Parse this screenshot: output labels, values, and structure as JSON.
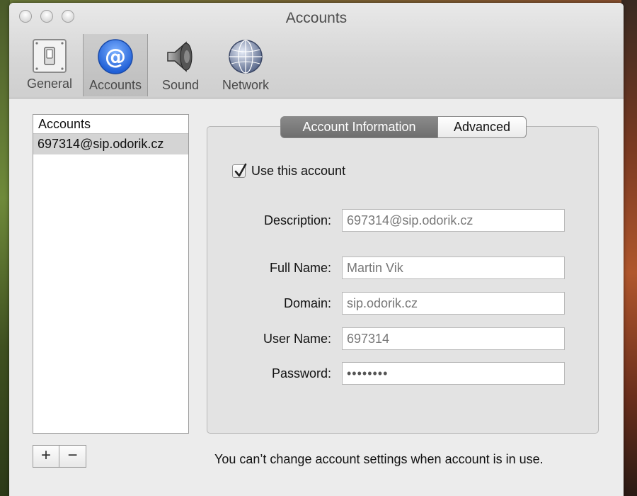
{
  "window": {
    "title": "Accounts"
  },
  "toolbar": {
    "items": [
      {
        "label": "General",
        "icon": "general-switch-icon"
      },
      {
        "label": "Accounts",
        "icon": "at-sign-icon"
      },
      {
        "label": "Sound",
        "icon": "speaker-icon"
      },
      {
        "label": "Network",
        "icon": "globe-icon"
      }
    ],
    "selected": "Accounts"
  },
  "sidebar": {
    "header": "Accounts",
    "items": [
      {
        "label": "697314@sip.odorik.cz",
        "selected": true
      }
    ],
    "add_label": "+",
    "remove_label": "−"
  },
  "tabs": [
    {
      "label": "Account Information",
      "active": true
    },
    {
      "label": "Advanced",
      "active": false
    }
  ],
  "form": {
    "use_account": {
      "label": "Use this account",
      "checked": true
    },
    "description": {
      "label": "Description:",
      "value": "697314@sip.odorik.cz"
    },
    "full_name": {
      "label": "Full Name:",
      "value": "Martin Vik"
    },
    "domain": {
      "label": "Domain:",
      "value": "sip.odorik.cz"
    },
    "user_name": {
      "label": "User Name:",
      "value": "697314"
    },
    "password": {
      "label": "Password:",
      "value": "••••••••"
    }
  },
  "notice": "You can’t change account settings when account is in use.",
  "colors": {
    "accent_blue": "#2f6fe0",
    "selected_row": "#d4d4d4",
    "active_tab": "#7a7a7a"
  }
}
